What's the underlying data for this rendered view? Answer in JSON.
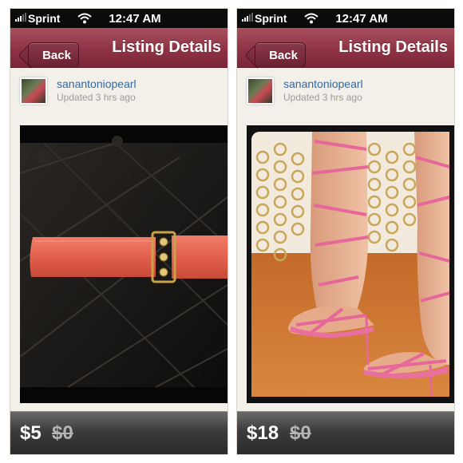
{
  "status_bar": {
    "carrier": "Sprint",
    "time": "12:47 AM"
  },
  "nav": {
    "back_label": "Back",
    "title": "Listing Details"
  },
  "listings": [
    {
      "seller": "sanantoniopearl",
      "updated": "Updated 3 hrs ago",
      "price": "$5",
      "original_price": "$0",
      "photo_subject": "coral elastic belt with gold buckle"
    },
    {
      "seller": "sanantoniopearl",
      "updated": "Updated 3 hrs ago",
      "price": "$18",
      "original_price": "$0",
      "photo_subject": "pink strappy lace-up heels"
    }
  ],
  "colors": {
    "navbar": "#8e3345",
    "username": "#2d6aa8",
    "background": "#f3f0ea",
    "pricebar": "#3c3c3c"
  }
}
